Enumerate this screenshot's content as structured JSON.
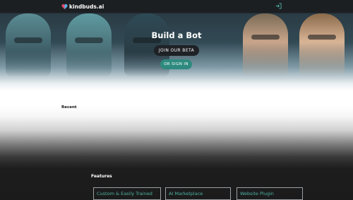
{
  "nav": {
    "brand": "kindbuds.ai",
    "brand_icon": "heart-logo-icon",
    "menu_icon": "signin-arrow-icon"
  },
  "hero": {
    "title": "Build a Bot",
    "join_label": "JOIN OUR BETA",
    "signin_label": "OR SIGN IN"
  },
  "sections": {
    "recent_heading": "Recent",
    "features_heading": "Features"
  },
  "features": [
    {
      "label": "Custom & Easily Trained"
    },
    {
      "label": "AI Marketplace"
    },
    {
      "label": "Website Plugin"
    }
  ],
  "colors": {
    "accent": "#2e8a7f",
    "feature_text": "#4fb3a5",
    "nav_bg": "#1c1f22"
  }
}
